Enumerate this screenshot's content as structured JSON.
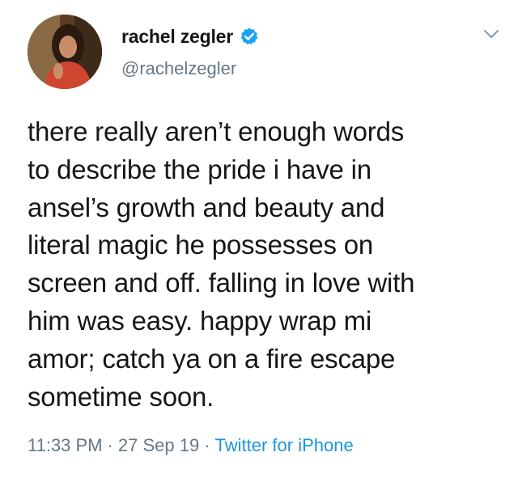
{
  "user": {
    "display_name": "rachel zegler",
    "handle": "@rachelzegler",
    "avatar_icon": "profile-photo",
    "verified_icon": "verified-badge-icon"
  },
  "tweet": {
    "text": "there really aren’t enough words\nto describe the pride i have in\nansel’s growth and beauty and\nliteral magic he possesses on\nscreen and off. falling in love with\nhim was easy. happy wrap mi\namor; catch ya on a fire escape\nsometime soon.",
    "time": "11:33 PM",
    "separator": "·",
    "date": "27 Sep 19",
    "source": "Twitter for iPhone"
  },
  "colors": {
    "text": "#14171a",
    "secondary": "#657786",
    "accent": "#1da1f2",
    "link": "#1b95e0"
  },
  "icons": {
    "more": "chevron-down-icon"
  }
}
